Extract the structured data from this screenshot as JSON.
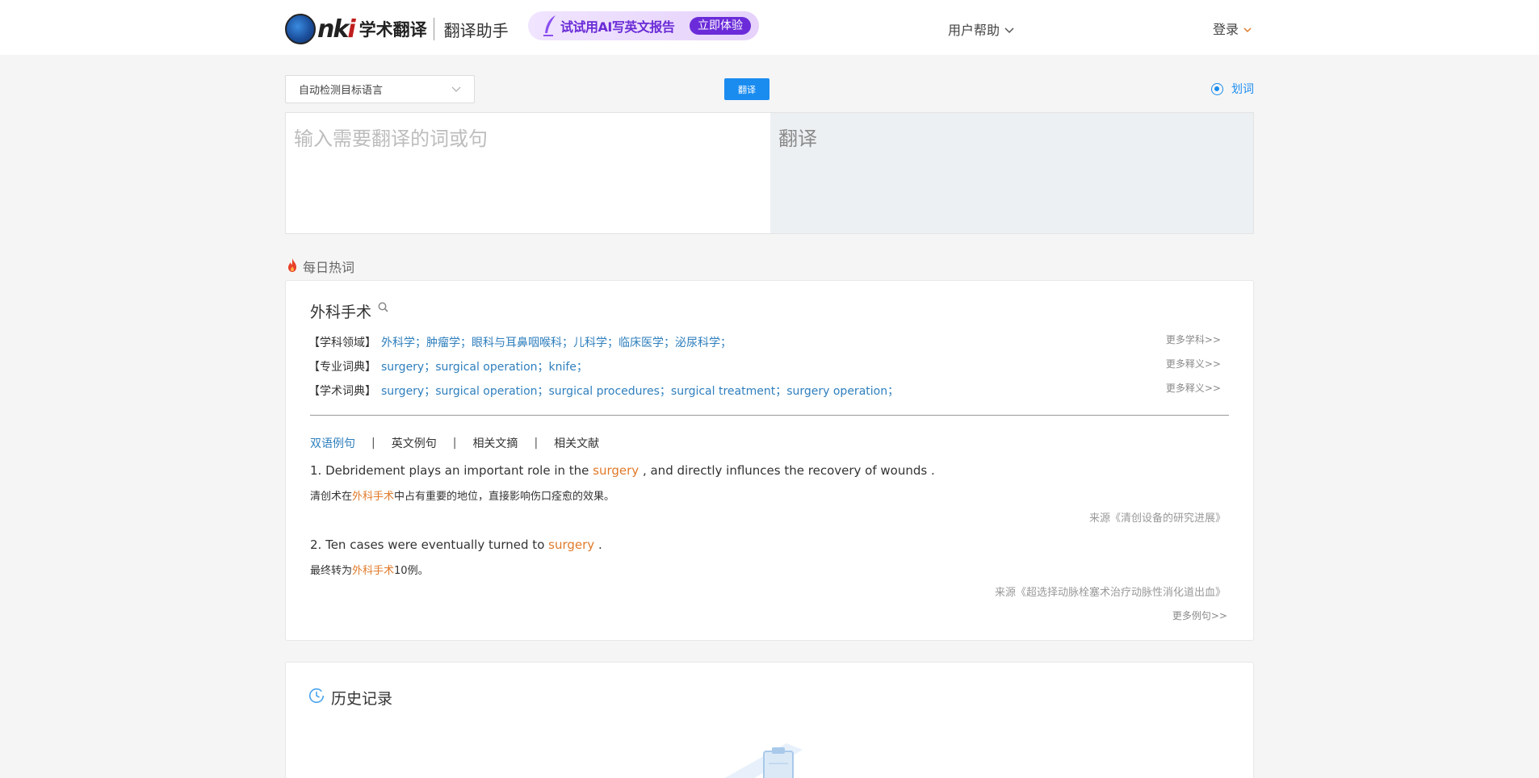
{
  "header": {
    "logo_text": "nki",
    "logo_title": "学术翻译",
    "product_name": "翻译助手",
    "promo_text": "试试用AI写英文报告",
    "promo_button": "立即体验",
    "help_label": "用户帮助",
    "login_label": "登录"
  },
  "translator": {
    "language_selected": "自动检测目标语言",
    "translate_button": "翻译",
    "huaci_label": "划词",
    "huaci_enabled": true,
    "input_placeholder": "输入需要翻译的词或句",
    "input_value": "",
    "output_placeholder": "翻译"
  },
  "daily_hot": {
    "section_title": "每日热词",
    "word": "外科手术",
    "rows": [
      {
        "label": "【学科领域】",
        "value": "外科学；肿瘤学；眼科与耳鼻咽喉科；儿科学；临床医学；泌尿科学；",
        "more": "更多学科>>"
      },
      {
        "label": "【专业词典】",
        "value": "surgery；surgical operation；knife；",
        "more": "更多释义>>"
      },
      {
        "label": "【学术词典】",
        "value": "surgery；surgical operation；surgical procedures；surgical treatment；surgery operation；",
        "more": "更多释义>>"
      }
    ],
    "tabs": [
      {
        "label": "双语例句",
        "active": true
      },
      {
        "label": "英文例句",
        "active": false
      },
      {
        "label": "相关文摘",
        "active": false
      },
      {
        "label": "相关文献",
        "active": false
      }
    ],
    "tab_separator": "|",
    "examples": [
      {
        "en_before": "1. Debridement plays an important role in the ",
        "en_highlight": "surgery",
        "en_after": " , and directly influnces the recovery of wounds .",
        "zh_before": "清创术在",
        "zh_highlight": "外科手术",
        "zh_after": "中占有重要的地位，直接影响伤口痊愈的效果。",
        "source": "来源《清创设备的研究进展》"
      },
      {
        "en_before": "2. Ten cases were eventually turned to ",
        "en_highlight": "surgery",
        "en_after": " .",
        "zh_before": "最终转为",
        "zh_highlight": "外科手术",
        "zh_after": "10例。",
        "source": "来源《超选择动脉栓塞术治疗动脉性消化道出血》"
      }
    ],
    "more_examples": "更多例句>>"
  },
  "history": {
    "title": "历史记录"
  },
  "colors": {
    "brand_blue": "#1a8cf0",
    "link_blue": "#2f7fbd",
    "highlight_orange": "#e07a2a",
    "promo_purple": "#6b2bd9"
  }
}
